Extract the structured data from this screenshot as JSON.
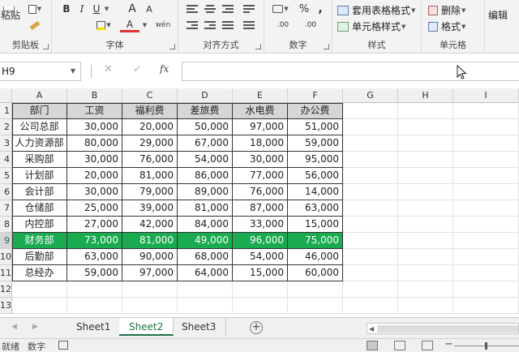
{
  "ribbon": {
    "clipboard": {
      "label": "剪贴板",
      "paste": "粘贴"
    },
    "font": {
      "label": "字体",
      "bold": "B",
      "italic": "I",
      "underline": "U",
      "grow": "A",
      "shrink": "A",
      "font_color": "A",
      "phonetic": "wén"
    },
    "alignment": {
      "label": "对齐方式"
    },
    "number": {
      "label": "数字",
      "percent": "%",
      "comma": ",",
      "increase_decimal": ".00",
      "decrease_decimal": ".00"
    },
    "styles": {
      "label": "样式",
      "format_table": "套用表格格式",
      "cell_styles": "单元格样式"
    },
    "cells": {
      "label": "单元格",
      "delete": "删除",
      "format": "格式"
    },
    "editing": {
      "label": "编辑"
    }
  },
  "formula_bar": {
    "name_box": "H9",
    "cancel": "✕",
    "enter": "✓",
    "fx": "fx",
    "formula": ""
  },
  "columns": [
    "A",
    "B",
    "C",
    "D",
    "E",
    "F",
    "G",
    "H",
    "I"
  ],
  "rows": [
    "1",
    "2",
    "3",
    "4",
    "5",
    "6",
    "7",
    "8",
    "9",
    "10",
    "11",
    "12",
    "13"
  ],
  "table": {
    "headers": [
      "部门",
      "工资",
      "福利费",
      "差旅费",
      "水电费",
      "办公费"
    ],
    "rows": [
      [
        "公司总部",
        "30,000",
        "20,000",
        "50,000",
        "97,000",
        "51,000"
      ],
      [
        "人力资源部",
        "80,000",
        "29,000",
        "67,000",
        "18,000",
        "59,000"
      ],
      [
        "采购部",
        "30,000",
        "76,000",
        "54,000",
        "30,000",
        "95,000"
      ],
      [
        "计划部",
        "20,000",
        "81,000",
        "86,000",
        "77,000",
        "56,000"
      ],
      [
        "会计部",
        "30,000",
        "79,000",
        "89,000",
        "76,000",
        "14,000"
      ],
      [
        "仓储部",
        "25,000",
        "39,000",
        "81,000",
        "87,000",
        "63,000"
      ],
      [
        "内控部",
        "27,000",
        "42,000",
        "84,000",
        "33,000",
        "15,000"
      ],
      [
        "财务部",
        "73,000",
        "81,000",
        "49,000",
        "96,000",
        "75,000"
      ],
      [
        "后勤部",
        "63,000",
        "90,000",
        "68,000",
        "54,000",
        "46,000"
      ],
      [
        "总经办",
        "59,000",
        "97,000",
        "64,000",
        "15,000",
        "60,000"
      ]
    ],
    "highlight_row_index": 7,
    "highlight_color": "#1aaa50"
  },
  "sheets": {
    "tabs": [
      "Sheet1",
      "Sheet2",
      "Sheet3"
    ],
    "active_index": 1,
    "add": "+"
  },
  "status": {
    "ready": "就绪",
    "mode": "数字"
  }
}
